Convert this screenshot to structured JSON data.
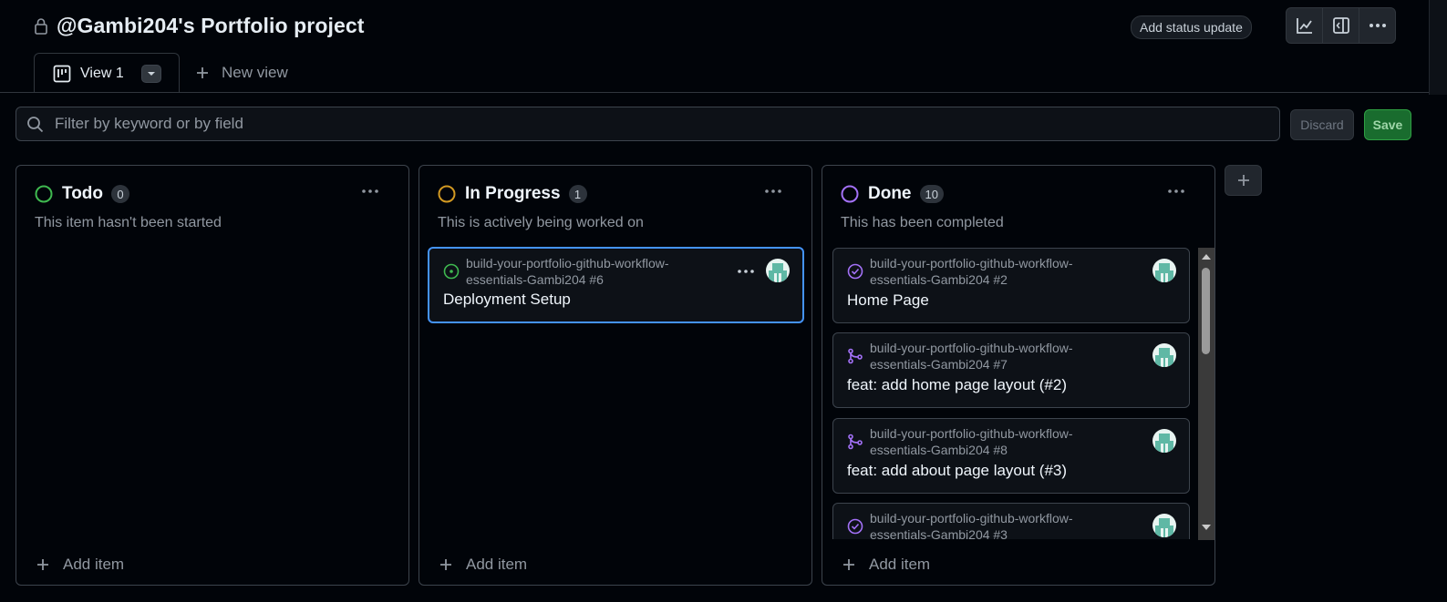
{
  "project": {
    "title": "@Gambi204's Portfolio project",
    "status_update_label": "Add status update",
    "icons": {
      "lock": "lock-icon",
      "insights": "graph-icon",
      "sidepanel": "sidebar-expand-icon",
      "more": "kebab-horizontal-icon"
    }
  },
  "tabs": [
    {
      "label": "View 1",
      "icon": "project-board-icon",
      "active": true
    }
  ],
  "new_view_label": "New view",
  "filter": {
    "placeholder": "Filter by keyword or by field",
    "value": ""
  },
  "actions": {
    "discard_label": "Discard",
    "save_label": "Save"
  },
  "colors": {
    "accent_blue": "#4493f8",
    "todo": "#3fb950",
    "in_progress": "#d29922",
    "done": "#a371f7",
    "save_bg": "#196c2e"
  },
  "columns": [
    {
      "name": "Todo",
      "count": "0",
      "description": "This item hasn't been started",
      "add_item_label": "Add item",
      "cards": []
    },
    {
      "name": "In Progress",
      "count": "1",
      "description": "This is actively being worked on",
      "add_item_label": "Add item",
      "cards": [
        {
          "repo_line1": "build-your-portfolio-github-workflow-",
          "repo_line2": "essentials-Gambi204 #6",
          "title": "Deployment Setup",
          "kind": "issue-open-icon"
        }
      ]
    },
    {
      "name": "Done",
      "count": "10",
      "description": "This has been completed",
      "add_item_label": "Add item",
      "cards": [
        {
          "repo_line1": "build-your-portfolio-github-workflow-",
          "repo_line2": "essentials-Gambi204 #2",
          "title": "Home Page",
          "kind": "issue-closed-icon"
        },
        {
          "repo_line1": "build-your-portfolio-github-workflow-",
          "repo_line2": "essentials-Gambi204 #7",
          "title": "feat: add home page layout (#2)",
          "kind": "pull-request-merged-icon"
        },
        {
          "repo_line1": "build-your-portfolio-github-workflow-",
          "repo_line2": "essentials-Gambi204 #8",
          "title": "feat: add about page layout (#3)",
          "kind": "pull-request-merged-icon"
        },
        {
          "repo_line1": "build-your-portfolio-github-workflow-",
          "repo_line2": "essentials-Gambi204 #3",
          "title": "",
          "kind": "issue-closed-icon"
        }
      ]
    }
  ]
}
